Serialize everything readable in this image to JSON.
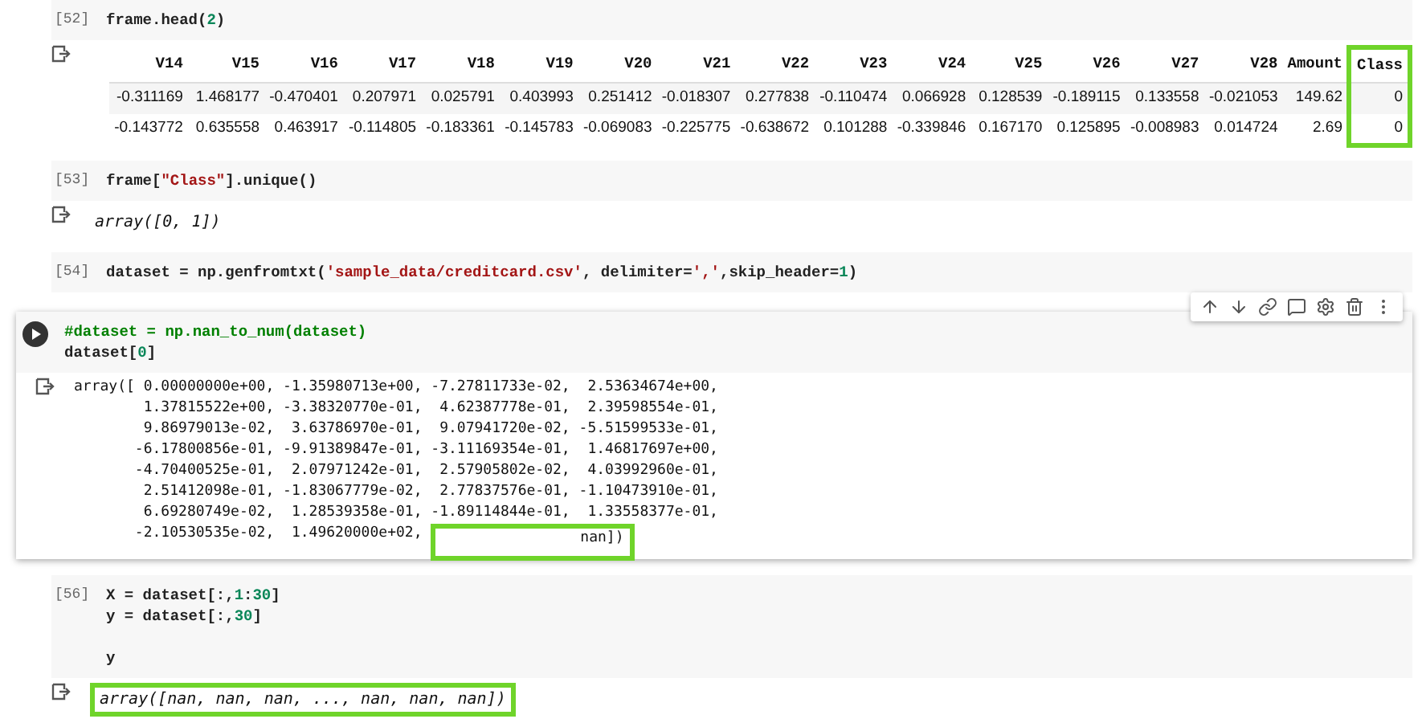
{
  "cells": [
    {
      "kind": "code",
      "prompt": "[52]",
      "active": false,
      "lines": [
        {
          "kind": "code",
          "tokens": [
            {
              "kind": "plain",
              "s": "frame.head("
            },
            {
              "kind": "number",
              "s": "2"
            },
            {
              "kind": "plain",
              "s": ")"
            }
          ]
        }
      ],
      "output": {
        "kind": "table",
        "columns": [
          {
            "label": "V14",
            "highlighted": false
          },
          {
            "label": "V15",
            "highlighted": false
          },
          {
            "label": "V16",
            "highlighted": false
          },
          {
            "label": "V17",
            "highlighted": false
          },
          {
            "label": "V18",
            "highlighted": false
          },
          {
            "label": "V19",
            "highlighted": false
          },
          {
            "label": "V20",
            "highlighted": false
          },
          {
            "label": "V21",
            "highlighted": false
          },
          {
            "label": "V22",
            "highlighted": false
          },
          {
            "label": "V23",
            "highlighted": false
          },
          {
            "label": "V24",
            "highlighted": false
          },
          {
            "label": "V25",
            "highlighted": false
          },
          {
            "label": "V26",
            "highlighted": false
          },
          {
            "label": "V27",
            "highlighted": false
          },
          {
            "label": "V28",
            "highlighted": false
          },
          {
            "label": "Amount",
            "highlighted": false
          },
          {
            "label": "Class",
            "highlighted": true
          }
        ],
        "rows": [
          [
            "-0.311169",
            "1.468177",
            "-0.470401",
            "0.207971",
            "0.025791",
            "0.403993",
            "0.251412",
            "-0.018307",
            "0.277838",
            "-0.110474",
            "0.066928",
            "0.128539",
            "-0.189115",
            "0.133558",
            "-0.021053",
            "149.62",
            "0"
          ],
          [
            "-0.143772",
            "0.635558",
            "0.463917",
            "-0.114805",
            "-0.183361",
            "-0.145783",
            "-0.069083",
            "-0.225775",
            "-0.638672",
            "0.101288",
            "-0.339846",
            "0.167170",
            "0.125895",
            "-0.008983",
            "0.014724",
            "2.69",
            "0"
          ]
        ]
      }
    },
    {
      "kind": "code",
      "prompt": "[53]",
      "active": false,
      "lines": [
        {
          "kind": "code",
          "tokens": [
            {
              "kind": "plain",
              "s": "frame["
            },
            {
              "kind": "string",
              "s": "\"Class\""
            },
            {
              "kind": "plain",
              "s": "].unique()"
            }
          ]
        }
      ],
      "output": {
        "kind": "text",
        "lines": [
          [
            {
              "text": "array([0, 1])",
              "highlighted": false
            }
          ]
        ]
      }
    },
    {
      "kind": "code",
      "prompt": "[54]",
      "active": false,
      "lines": [
        {
          "kind": "code",
          "tokens": [
            {
              "kind": "plain",
              "s": "dataset = np.genfromtxt("
            },
            {
              "kind": "string",
              "s": "'sample_data/creditcard.csv'"
            },
            {
              "kind": "plain",
              "s": ", delimiter="
            },
            {
              "kind": "string",
              "s": "','"
            },
            {
              "kind": "plain",
              "s": ",skip_header="
            },
            {
              "kind": "number",
              "s": "1"
            },
            {
              "kind": "plain",
              "s": ")"
            }
          ]
        }
      ]
    },
    {
      "kind": "code",
      "active": true,
      "lines": [
        {
          "kind": "code",
          "tokens": [
            {
              "kind": "comment",
              "s": "#dataset = np.nan_to_num(dataset)"
            }
          ]
        },
        {
          "kind": "code",
          "tokens": [
            {
              "kind": "plain",
              "s": "dataset["
            },
            {
              "kind": "number",
              "s": "0"
            },
            {
              "kind": "plain",
              "s": "]"
            }
          ]
        }
      ],
      "output": {
        "kind": "array",
        "lines": [
          [
            {
              "text": "array([ 0.00000000e+00, -1.35980713e+00, -7.27811733e-02,  2.53634674e+00,",
              "highlighted": false
            }
          ],
          [
            {
              "text": "        1.37815522e+00, -3.38320770e-01,  4.62387778e-01,  2.39598554e-01,",
              "highlighted": false
            }
          ],
          [
            {
              "text": "        9.86979013e-02,  3.63786970e-01,  9.07941720e-02, -5.51599533e-01,",
              "highlighted": false
            }
          ],
          [
            {
              "text": "       -6.17800856e-01, -9.91389847e-01, -3.11169354e-01,  1.46817697e+00,",
              "highlighted": false
            }
          ],
          [
            {
              "text": "       -4.70400525e-01,  2.07971242e-01,  2.57905802e-02,  4.03992960e-01,",
              "highlighted": false
            }
          ],
          [
            {
              "text": "        2.51412098e-01, -1.83067779e-02,  2.77837576e-01, -1.10473910e-01,",
              "highlighted": false
            }
          ],
          [
            {
              "text": "        6.69280749e-02,  1.28539358e-01, -1.89114844e-01,  1.33558377e-01,",
              "highlighted": false
            }
          ],
          [
            {
              "text": "       -2.10530535e-02,  1.49620000e+02, ",
              "highlighted": false
            },
            {
              "text": "nan])",
              "highlighted": true
            }
          ]
        ]
      }
    },
    {
      "kind": "code",
      "prompt": "[56]",
      "active": false,
      "lines": [
        {
          "kind": "code",
          "tokens": [
            {
              "kind": "plain",
              "s": "X = dataset[:,"
            },
            {
              "kind": "number",
              "s": "1"
            },
            {
              "kind": "plain",
              "s": ":"
            },
            {
              "kind": "number",
              "s": "30"
            },
            {
              "kind": "plain",
              "s": "]"
            }
          ]
        },
        {
          "kind": "code",
          "tokens": [
            {
              "kind": "plain",
              "s": "y = dataset[:,"
            },
            {
              "kind": "number",
              "s": "30"
            },
            {
              "kind": "plain",
              "s": "]"
            }
          ]
        },
        {
          "kind": "blank"
        },
        {
          "kind": "code",
          "tokens": [
            {
              "kind": "plain",
              "s": "y"
            }
          ]
        }
      ],
      "output": {
        "kind": "text",
        "lines": [
          [
            {
              "text": "array([nan, nan, nan, ..., nan, nan, nan])",
              "highlighted": true
            }
          ]
        ]
      }
    }
  ]
}
